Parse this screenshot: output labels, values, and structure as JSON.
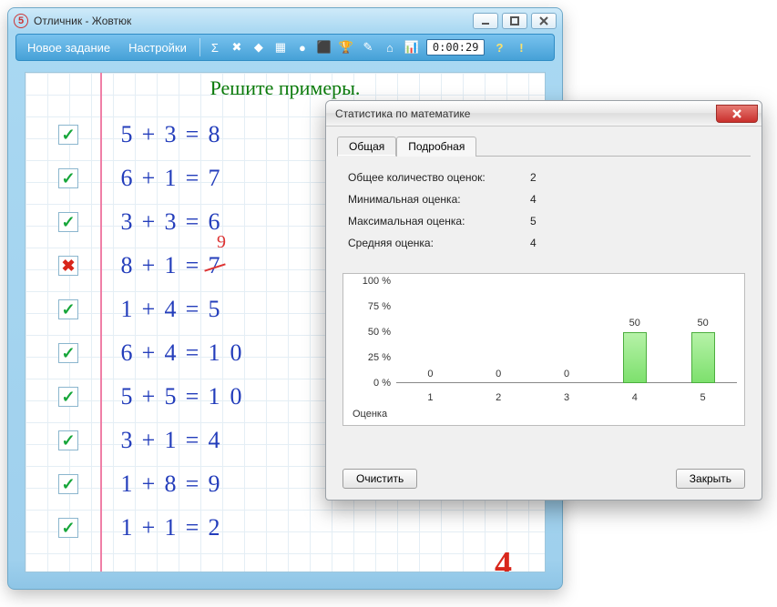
{
  "window": {
    "title": "Отличник - Жовтюк",
    "app_icon_glyph": "5"
  },
  "toolbar": {
    "menu_new": "Новое задание",
    "menu_settings": "Настройки",
    "timer": "0:00:29",
    "icons": [
      "Σ",
      "✖",
      "◆",
      "▦",
      "●",
      "⬛",
      "🏆",
      "✎",
      "⌂",
      "📊"
    ],
    "help_glyph": "?",
    "exclaim_glyph": "!"
  },
  "worksheet": {
    "title": "Решите примеры.",
    "grade": "4",
    "problems": [
      {
        "a": "5",
        "op": "+",
        "b": "3",
        "eq": "=",
        "ans": [
          "8"
        ],
        "correct": true
      },
      {
        "a": "6",
        "op": "+",
        "b": "1",
        "eq": "=",
        "ans": [
          "7"
        ],
        "correct": true
      },
      {
        "a": "3",
        "op": "+",
        "b": "3",
        "eq": "=",
        "ans": [
          "6"
        ],
        "correct": true
      },
      {
        "a": "8",
        "op": "+",
        "b": "1",
        "eq": "=",
        "ans": [
          "7"
        ],
        "correct": false,
        "correction": "9"
      },
      {
        "a": "1",
        "op": "+",
        "b": "4",
        "eq": "=",
        "ans": [
          "5"
        ],
        "correct": true
      },
      {
        "a": "6",
        "op": "+",
        "b": "4",
        "eq": "=",
        "ans": [
          "1",
          "0"
        ],
        "correct": true
      },
      {
        "a": "5",
        "op": "+",
        "b": "5",
        "eq": "=",
        "ans": [
          "1",
          "0"
        ],
        "correct": true
      },
      {
        "a": "3",
        "op": "+",
        "b": "1",
        "eq": "=",
        "ans": [
          "4"
        ],
        "correct": true
      },
      {
        "a": "1",
        "op": "+",
        "b": "8",
        "eq": "=",
        "ans": [
          "9"
        ],
        "correct": true
      },
      {
        "a": "1",
        "op": "+",
        "b": "1",
        "eq": "=",
        "ans": [
          "2"
        ],
        "correct": true
      }
    ]
  },
  "dialog": {
    "title": "Статистика по математике",
    "tab_general": "Общая",
    "tab_detailed": "Подробная",
    "stats": {
      "total_label": "Общее количество оценок:",
      "total_value": "2",
      "min_label": "Минимальная оценка:",
      "min_value": "4",
      "max_label": "Максимальная оценка:",
      "max_value": "5",
      "avg_label": "Средняя оценка:",
      "avg_value": "4"
    },
    "btn_clear": "Очистить",
    "btn_close": "Закрыть",
    "x_axis_title": "Оценка"
  },
  "chart_data": {
    "type": "bar",
    "title": "",
    "xlabel": "Оценка",
    "ylabel": "",
    "categories": [
      "1",
      "2",
      "3",
      "4",
      "5"
    ],
    "values": [
      0,
      0,
      0,
      50,
      50
    ],
    "y_ticks": [
      "100 %",
      "75 %",
      "50 %",
      "25 %",
      "0 %"
    ],
    "ylim": [
      0,
      100
    ]
  }
}
